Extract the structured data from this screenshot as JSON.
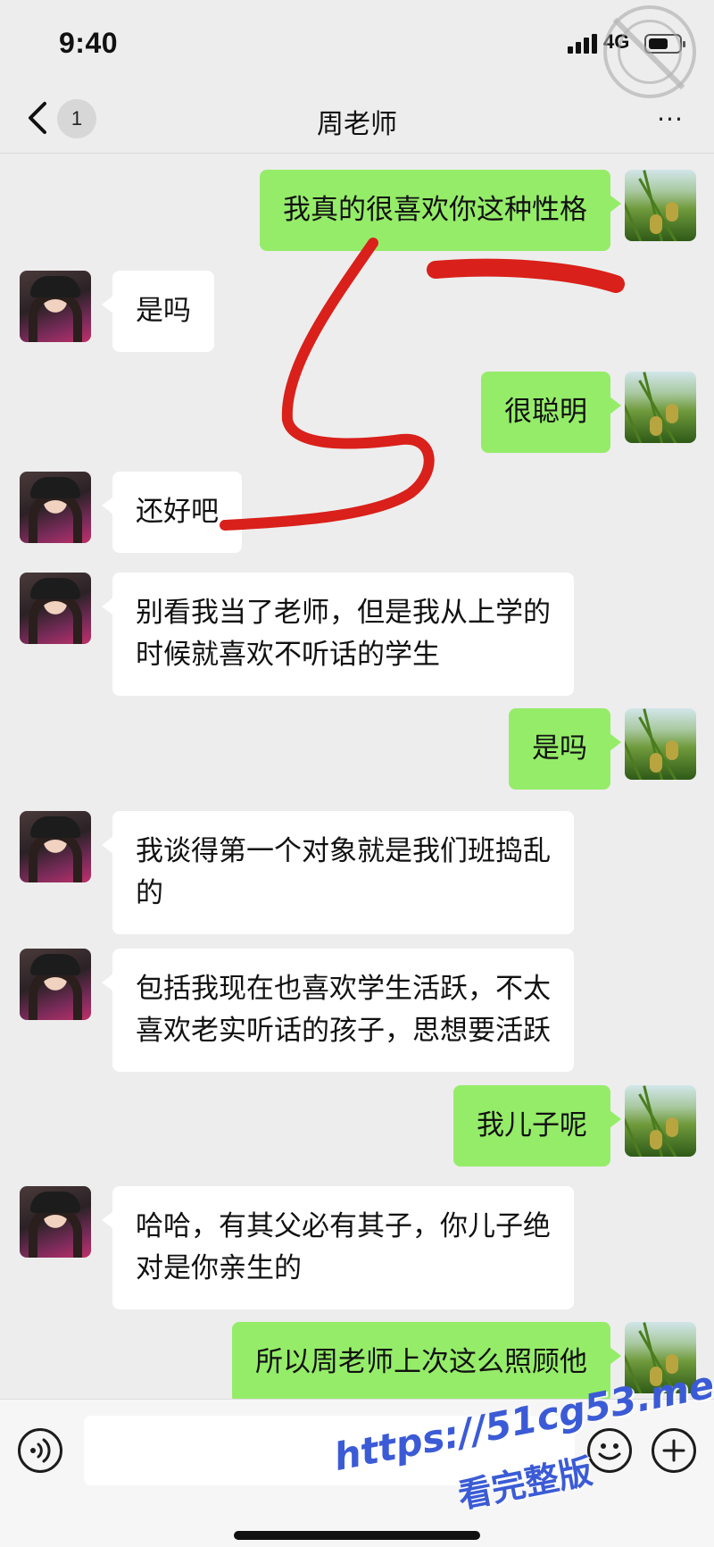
{
  "status_bar": {
    "time": "9:40",
    "network": "4G",
    "battery_level": 0.65
  },
  "nav": {
    "unread_count": "1",
    "title": "周老师",
    "more_label": "···"
  },
  "messages": [
    {
      "side": "right",
      "text": "我真的很喜欢你这种性格"
    },
    {
      "side": "left",
      "text": "是吗"
    },
    {
      "side": "right",
      "text": "很聪明"
    },
    {
      "side": "left",
      "text": "还好吧"
    },
    {
      "side": "left",
      "text": "别看我当了老师，但是我从上学的\n时候就喜欢不听话的学生"
    },
    {
      "side": "right",
      "text": "是吗"
    },
    {
      "side": "left",
      "text": "我谈得第一个对象就是我们班捣乱\n的"
    },
    {
      "side": "left",
      "text": "包括我现在也喜欢学生活跃，不太\n喜欢老实听话的孩子，思想要活跃"
    },
    {
      "side": "right",
      "text": "我儿子呢"
    },
    {
      "side": "left",
      "text": "哈哈，有其父必有其子，你儿子绝\n对是你亲生的"
    },
    {
      "side": "right",
      "text": "所以周老师上次这么照顾他"
    }
  ],
  "input": {
    "value": ""
  },
  "watermark": {
    "url": "https://51cg53.me",
    "cta": "看完整版"
  },
  "colors": {
    "sent_bubble": "#95ec69",
    "received_bubble": "#ffffff",
    "background": "#ededed",
    "annotation": "#d9201a",
    "watermark_text": "#3b5bd6"
  }
}
